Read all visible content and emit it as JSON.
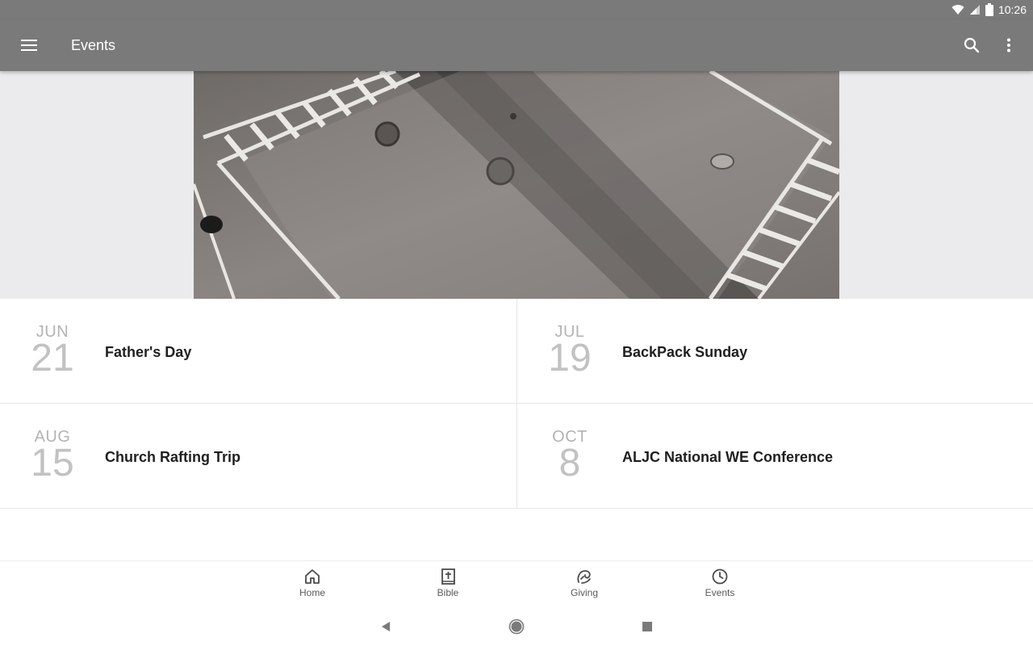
{
  "status": {
    "time": "10:26",
    "icons": [
      "wifi-icon",
      "signal-icon",
      "battery-icon"
    ]
  },
  "app_bar": {
    "title": "Events",
    "menu_icon": "menu-icon",
    "search_icon": "search-icon",
    "more_icon": "more-vert-icon",
    "background": "#7a7a7a"
  },
  "hero": {
    "description": "grayscale aerial crosswalk photo"
  },
  "events": [
    {
      "month": "JUN",
      "day": "21",
      "title": "Father's Day"
    },
    {
      "month": "JUL",
      "day": "19",
      "title": "BackPack Sunday"
    },
    {
      "month": "AUG",
      "day": "15",
      "title": "Church Rafting Trip"
    },
    {
      "month": "OCT",
      "day": "8",
      "title": "ALJC National WE Conference"
    }
  ],
  "bottom_nav": [
    {
      "label": "Home",
      "icon": "home-icon"
    },
    {
      "label": "Bible",
      "icon": "bible-icon"
    },
    {
      "label": "Giving",
      "icon": "giving-icon"
    },
    {
      "label": "Events",
      "icon": "clock-icon"
    }
  ],
  "system_nav": [
    "back-icon",
    "home-circle-icon",
    "recents-icon"
  ]
}
